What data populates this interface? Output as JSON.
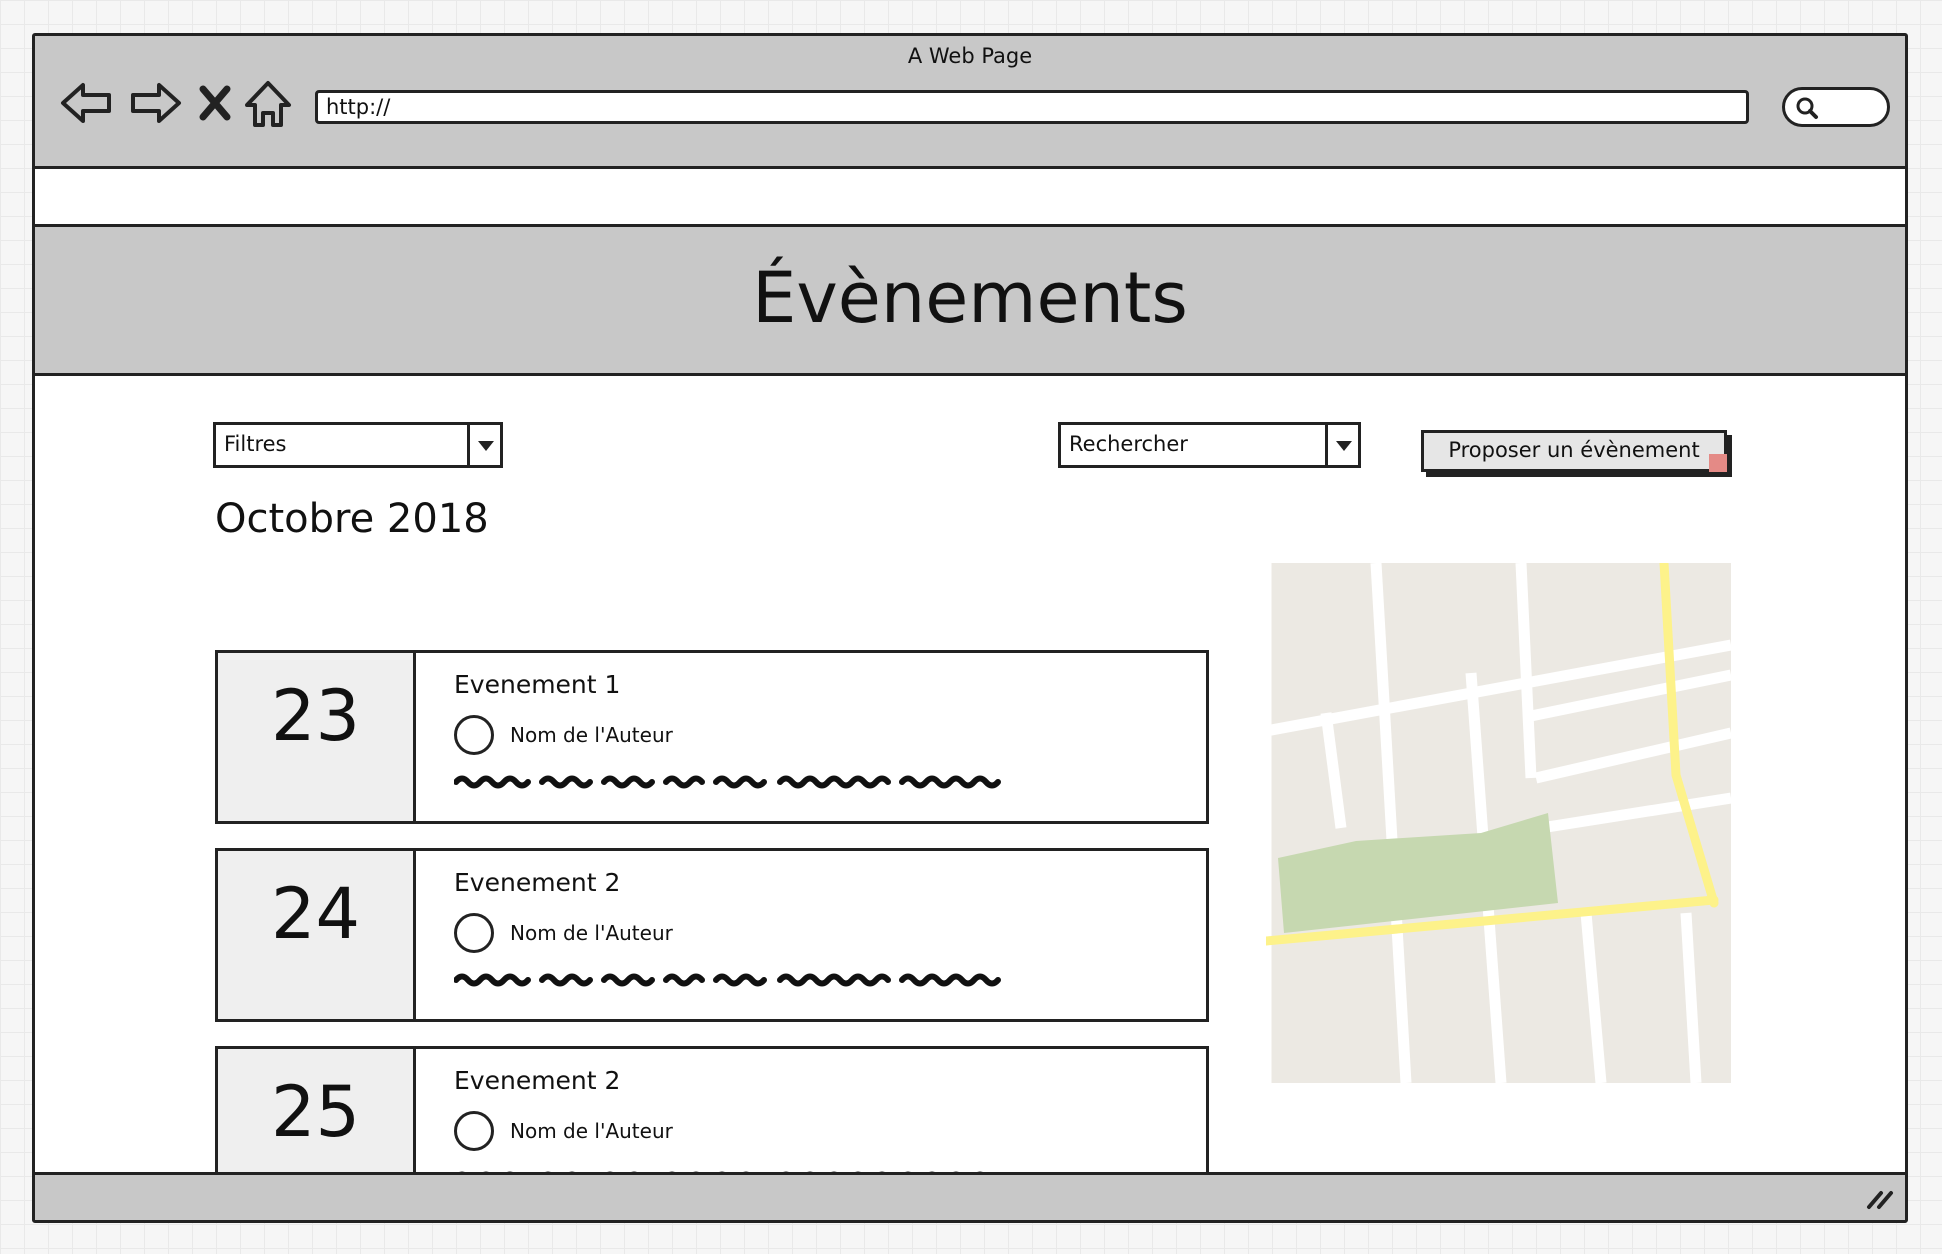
{
  "browser": {
    "window_title": "A Web Page",
    "url": "http://",
    "icons": [
      "back-arrow-icon",
      "forward-arrow-icon",
      "stop-icon",
      "home-icon",
      "search-icon",
      "resize-grip-icon"
    ]
  },
  "header": {
    "title": "Évènements"
  },
  "toolbar": {
    "filter_label": "Filtres",
    "search_label": "Rechercher",
    "propose_label": "Proposer un évènement"
  },
  "month": "Octobre 2018",
  "events": [
    {
      "day": "23",
      "title": "Evenement 1",
      "author": "Nom de l'Auteur"
    },
    {
      "day": "24",
      "title": "Evenement 2",
      "author": "Nom de l'Auteur"
    },
    {
      "day": "25",
      "title": "Evenement 2",
      "author": "Nom de l'Auteur"
    }
  ],
  "colors": {
    "chrome": "#c8c8c8",
    "map_land": "#ece9e3",
    "map_park": "#c6d8b0",
    "map_road_major": "#fdf28a",
    "accent_corner": "#e48a86"
  }
}
